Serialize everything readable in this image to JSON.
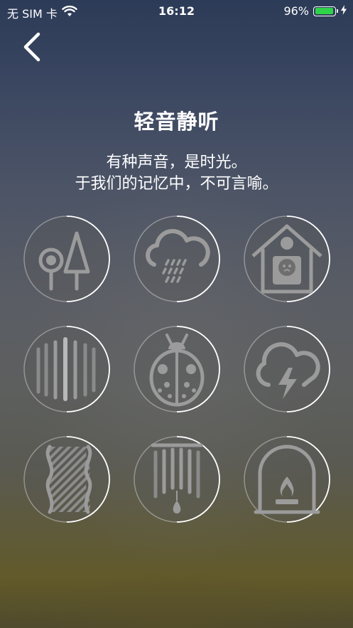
{
  "status_bar": {
    "carrier": "无 SIM 卡",
    "time": "16:12",
    "battery_percent": "96%",
    "battery_level": 0.96,
    "battery_color": "#2fd34a"
  },
  "nav": {
    "back_icon": "chevron-left-icon"
  },
  "page": {
    "title": "轻音静听",
    "subtitle_line1": "有种声音，是时光。",
    "subtitle_line2": "于我们的记忆中，不可言喻。"
  },
  "sounds": [
    {
      "icon": "forest-icon"
    },
    {
      "icon": "rain-cloud-icon"
    },
    {
      "icon": "birdhouse-icon"
    },
    {
      "icon": "waterfall-icon"
    },
    {
      "icon": "ladybug-icon"
    },
    {
      "icon": "thunderstorm-icon"
    },
    {
      "icon": "ocean-waves-icon"
    },
    {
      "icon": "wind-chime-icon"
    },
    {
      "icon": "fireplace-icon"
    }
  ]
}
